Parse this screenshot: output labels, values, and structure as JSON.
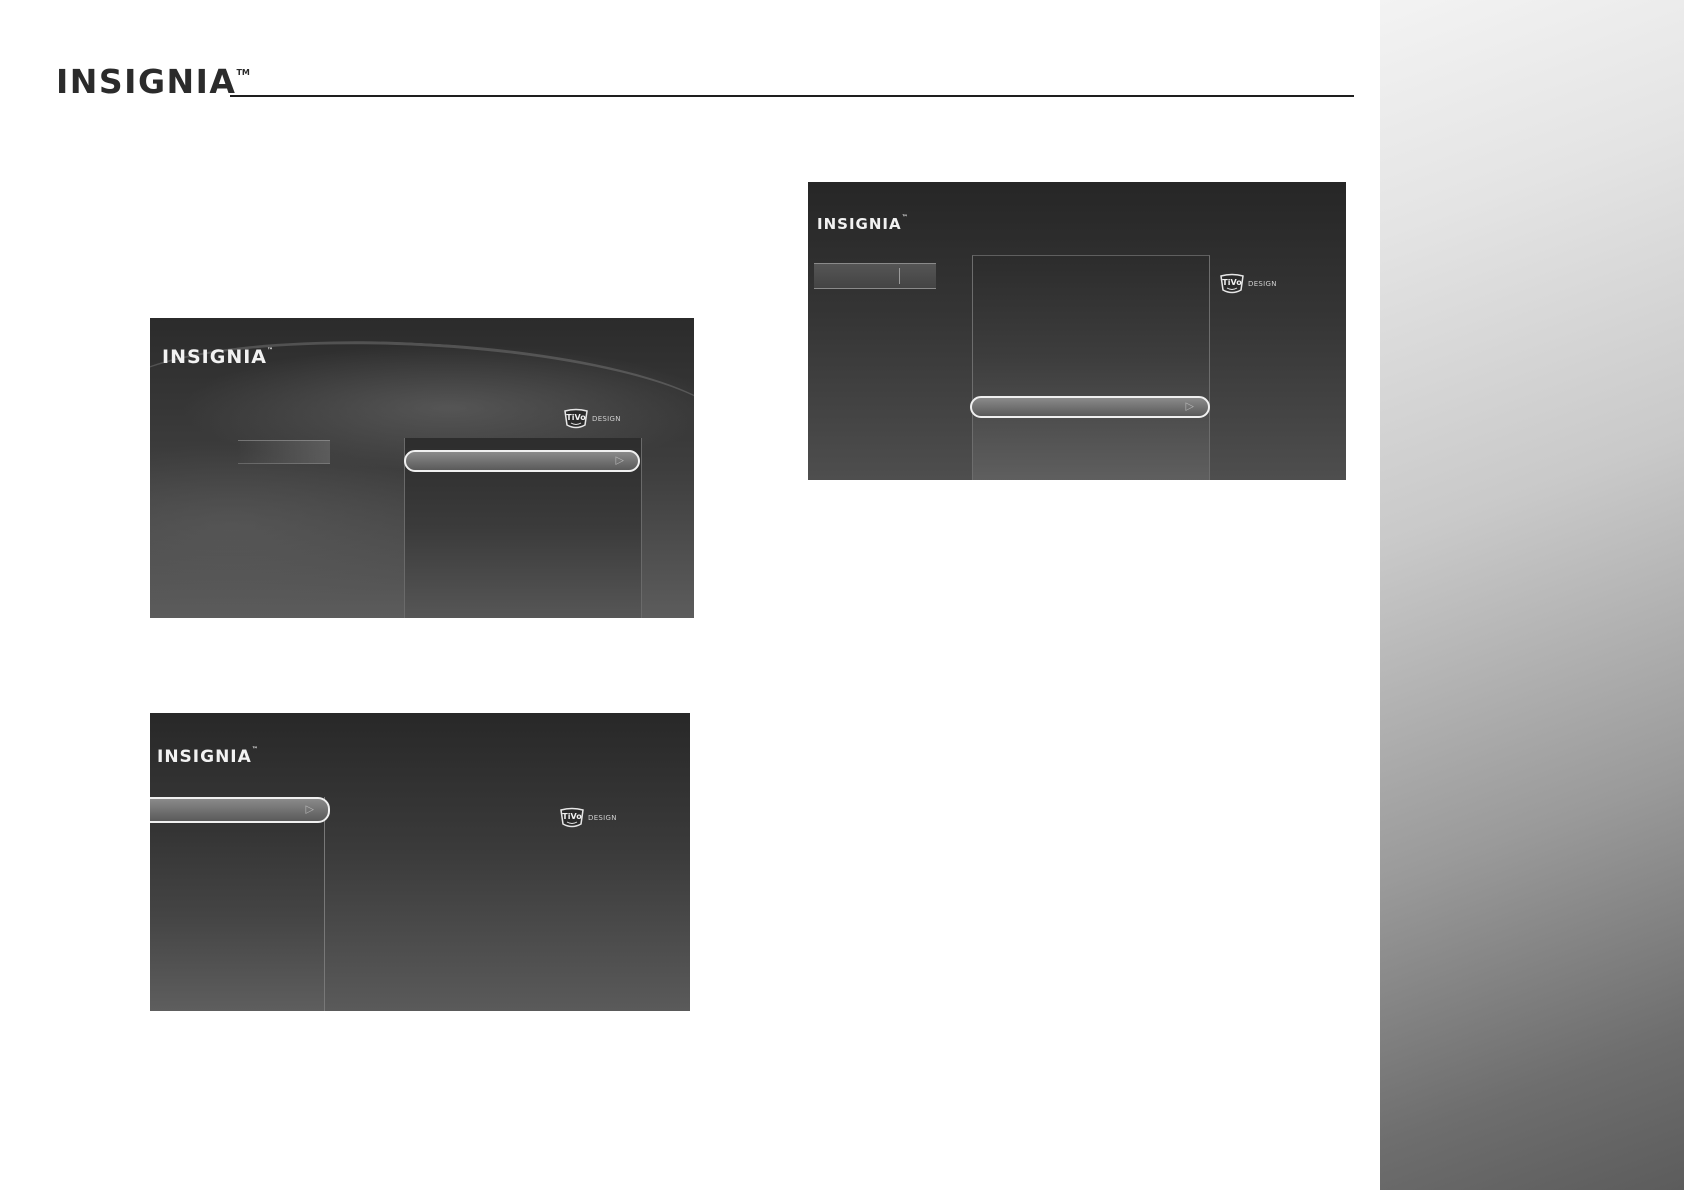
{
  "header": {
    "logo_text": "INSIGNIA",
    "trademark": "TM"
  },
  "screens": [
    {
      "id": "a",
      "brand": "INSIGNIA",
      "badge": "DESIGN",
      "arrow": "▷"
    },
    {
      "id": "b",
      "brand": "INSIGNIA",
      "badge": "DESIGN",
      "arrow": "▷"
    },
    {
      "id": "c",
      "brand": "INSIGNIA",
      "badge": "DESIGN",
      "arrow": "▷"
    }
  ],
  "colors": {
    "screen_bg": "#2b2b2b",
    "highlight_border": "#f0f0f0",
    "side_gradient_top": "#f3f3f3",
    "side_gradient_bottom": "#5c5c5c"
  }
}
